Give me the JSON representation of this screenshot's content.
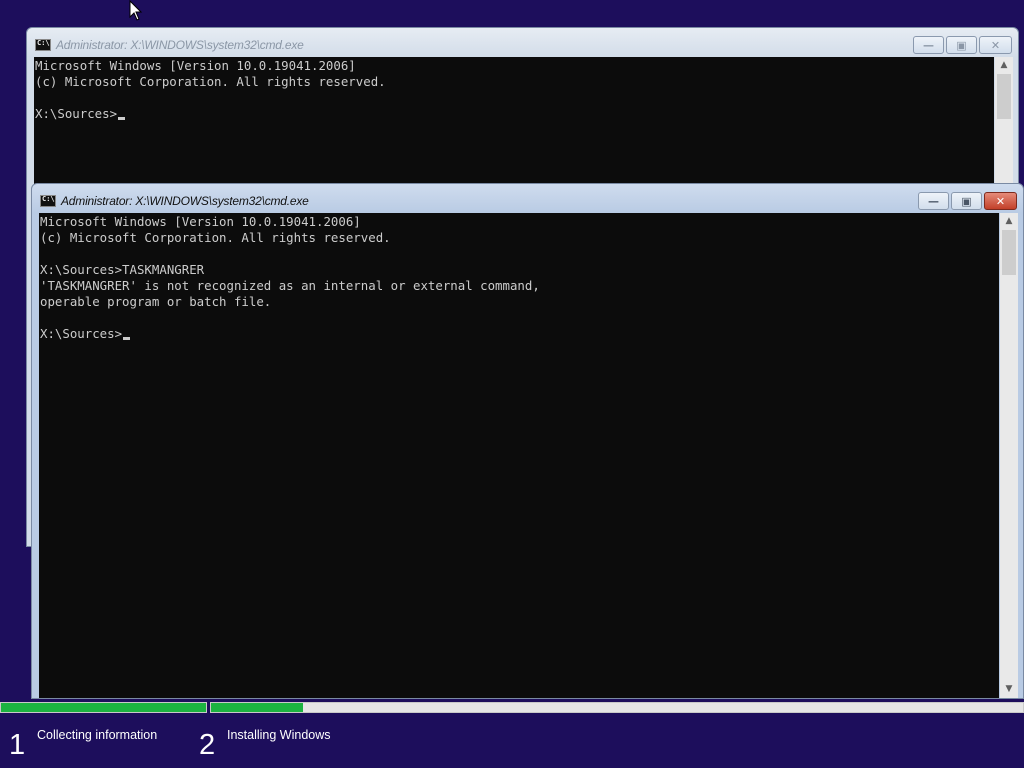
{
  "windows": [
    {
      "title": "Administrator: X:\\WINDOWS\\system32\\cmd.exe",
      "state": "inactive",
      "lines": [
        "Microsoft Windows [Version 10.0.19041.2006]",
        "(c) Microsoft Corporation. All rights reserved.",
        "",
        "X:\\Sources>"
      ]
    },
    {
      "title": "Administrator: X:\\WINDOWS\\system32\\cmd.exe",
      "state": "active",
      "lines": [
        "Microsoft Windows [Version 10.0.19041.2006]",
        "(c) Microsoft Corporation. All rights reserved.",
        "",
        "X:\\Sources>TASKMANGRER",
        "'TASKMANGRER' is not recognized as an internal or external command,",
        "operable program or batch file.",
        "",
        "X:\\Sources>"
      ]
    }
  ],
  "caption_buttons": {
    "minimize": "minimize-icon",
    "maximize": "maximize-icon",
    "close": "close-icon"
  },
  "setup": {
    "steps": [
      {
        "number": "1",
        "label": "Collecting information",
        "progress": 1.0
      },
      {
        "number": "2",
        "label": "Installing Windows",
        "progress": 0.113
      }
    ],
    "progress_color": "#1cb341",
    "background_color": "#1d0e5c"
  }
}
